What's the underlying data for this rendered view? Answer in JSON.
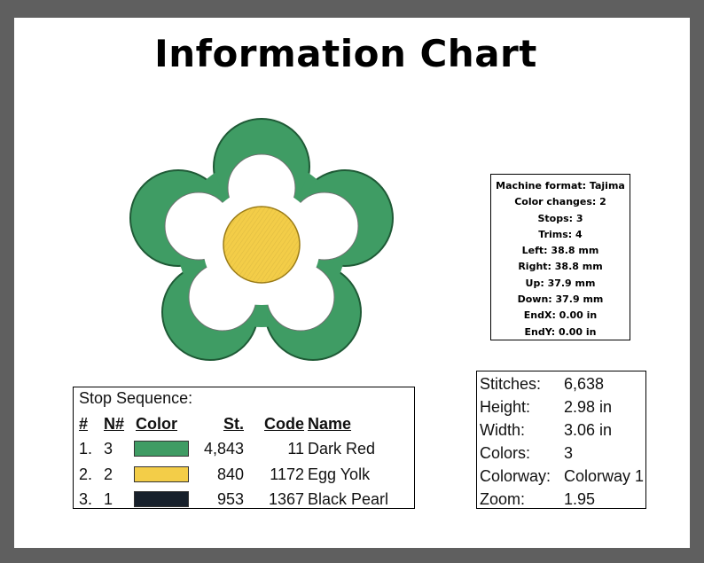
{
  "title": "Information Chart",
  "colors": {
    "green": "#3f9c64",
    "yellow": "#f3cd48",
    "black_pearl": "#17202b",
    "frame": "#5f5f5f"
  },
  "design": {
    "icon": "flower-embroidery-icon"
  },
  "machine_info": {
    "lines": [
      "Machine format: Tajima",
      "Color changes: 2",
      "Stops: 3",
      "Trims: 4",
      "Left: 38.8 mm",
      "Right: 38.8 mm",
      "Up: 37.9 mm",
      "Down: 37.9 mm",
      "EndX: 0.00 in",
      "EndY: 0.00 in"
    ]
  },
  "stop_sequence": {
    "title": "Stop Sequence:",
    "headers": {
      "num": "#",
      "n": "N#",
      "color": "Color",
      "st": "St.",
      "code": "Code",
      "name": "Name"
    },
    "rows": [
      {
        "num": "1.",
        "n": "3",
        "st": "4,843",
        "code": "11",
        "name": "Dark Red",
        "swatch": "#3f9c64"
      },
      {
        "num": "2.",
        "n": "2",
        "st": "840",
        "code": "1172",
        "name": "Egg Yolk",
        "swatch": "#f3cd48"
      },
      {
        "num": "3.",
        "n": "1",
        "st": "953",
        "code": "1367",
        "name": "Black Pearl",
        "swatch": "#17202b"
      }
    ]
  },
  "stats": [
    {
      "label": "Stitches:",
      "value": "6,638"
    },
    {
      "label": "Height:",
      "value": "2.98 in"
    },
    {
      "label": "Width:",
      "value": "3.06 in"
    },
    {
      "label": "Colors:",
      "value": "3"
    },
    {
      "label": "Colorway:",
      "value": "Colorway 1"
    },
    {
      "label": "Zoom:",
      "value": "1.95"
    }
  ]
}
